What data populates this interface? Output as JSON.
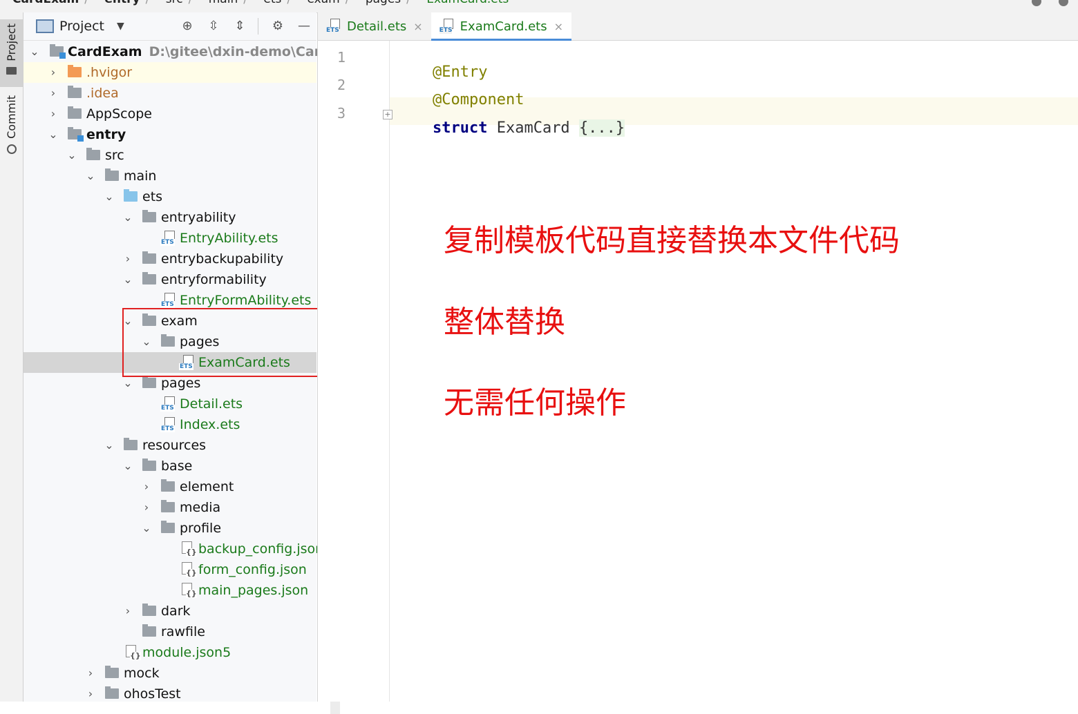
{
  "breadcrumb": {
    "items": [
      "CardExam",
      "entry",
      "src",
      "main",
      "ets",
      "exam",
      "pages",
      "ExamCard.ets"
    ]
  },
  "toolstrip": {
    "project_label": "Project",
    "commit_label": "Commit"
  },
  "project_panel": {
    "title": "Project",
    "caret": "▼",
    "tools": [
      "target-icon",
      "expand-all-icon",
      "collapse-all-icon",
      "gear-icon",
      "minimize-icon"
    ]
  },
  "tree": {
    "root_name": "CardExam",
    "root_path": "D:\\gitee\\dxin-demo\\CardExam",
    "rows": [
      {
        "label": "CardExam",
        "expanded": true
      },
      {
        "label": ".hvigor",
        "expanded": false
      },
      {
        "label": ".idea",
        "expanded": false
      },
      {
        "label": "AppScope",
        "expanded": false
      },
      {
        "label": "entry",
        "expanded": true
      },
      {
        "label": "src",
        "expanded": true
      },
      {
        "label": "main",
        "expanded": true
      },
      {
        "label": "ets",
        "expanded": true
      },
      {
        "label": "entryability",
        "expanded": true
      },
      {
        "label": "EntryAbility.ets"
      },
      {
        "label": "entrybackupability",
        "expanded": false
      },
      {
        "label": "entryformability",
        "expanded": true
      },
      {
        "label": "EntryFormAbility.ets"
      },
      {
        "label": "exam",
        "expanded": true
      },
      {
        "label": "pages",
        "expanded": true
      },
      {
        "label": "ExamCard.ets",
        "selected": true
      },
      {
        "label": "pages",
        "expanded": true
      },
      {
        "label": "Detail.ets"
      },
      {
        "label": "Index.ets"
      },
      {
        "label": "resources",
        "expanded": true
      },
      {
        "label": "base",
        "expanded": true
      },
      {
        "label": "element",
        "expanded": false
      },
      {
        "label": "media",
        "expanded": false
      },
      {
        "label": "profile",
        "expanded": true
      },
      {
        "label": "backup_config.json"
      },
      {
        "label": "form_config.json"
      },
      {
        "label": "main_pages.json"
      },
      {
        "label": "dark",
        "expanded": false
      },
      {
        "label": "rawfile"
      },
      {
        "label": "module.json5"
      },
      {
        "label": "mock",
        "expanded": false
      },
      {
        "label": "ohosTest",
        "expanded": false
      }
    ]
  },
  "editor": {
    "tabs": [
      {
        "label": "Detail.ets",
        "active": false
      },
      {
        "label": "ExamCard.ets",
        "active": true
      }
    ],
    "tab_icon_tag": "ETS",
    "close_glyph": "×",
    "lines": [
      {
        "num": "1",
        "anno": "@Entry"
      },
      {
        "num": "2",
        "anno": "@Component"
      },
      {
        "num": "3",
        "kw": "struct",
        "ident": "ExamCard",
        "folded": "{...}"
      }
    ],
    "fold_glyph": "+"
  },
  "annotations": {
    "line1": "复制模板代码直接替换本文件代码",
    "line2": "整体替换",
    "line3": "无需任何操作",
    "color": "#e81010"
  },
  "icons": {
    "ets_tag": "ETS",
    "json_brace": "{}"
  }
}
